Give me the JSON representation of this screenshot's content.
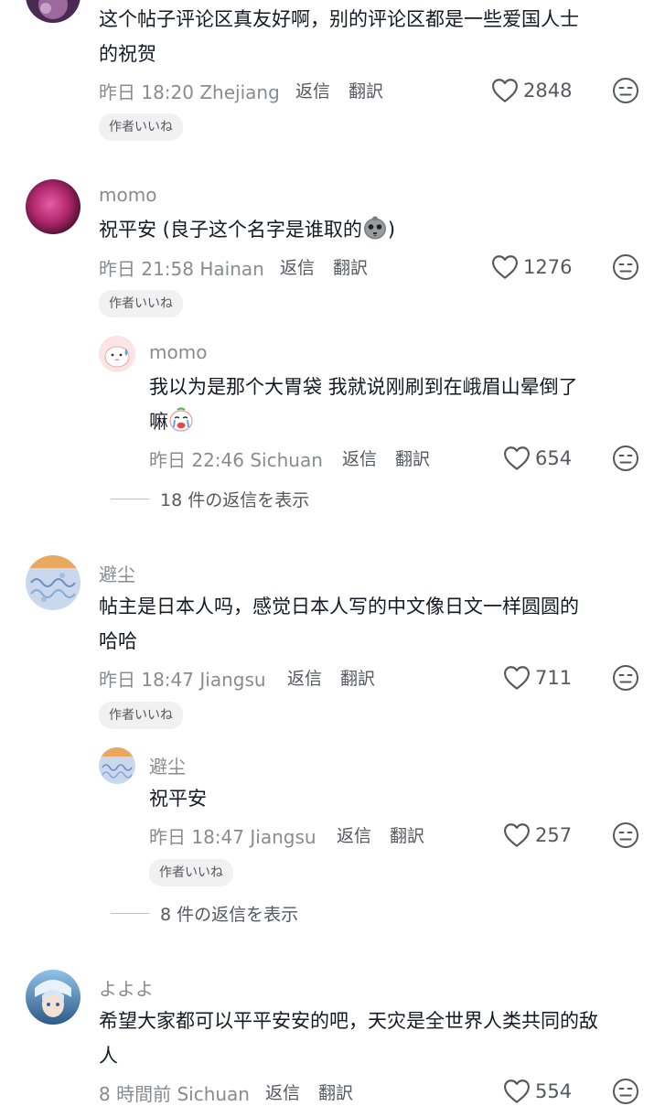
{
  "comments": [
    {
      "text_line1": "这个帖子评论区真友好啊，别的评论区都是一些爱国人士",
      "text_line2": "的祝贺",
      "time": "昨日 18:20",
      "location": "Zhejiang",
      "reply": "返信",
      "translate": "翻訳",
      "likes": "2848",
      "author_liked": "作者いいね",
      "avatar_color": "#4a2a55"
    },
    {
      "username": "momo",
      "text_line1": "祝平安 (良子这个名字是谁取的",
      "text_line1_end": ")",
      "emoji": "skull-emoji",
      "time": "昨日 21:58",
      "location": "Hainan",
      "reply": "返信",
      "translate": "翻訳",
      "likes": "1276",
      "author_liked": "作者いいね",
      "avatar_color": "#b0286e",
      "replies": [
        {
          "username": "momo",
          "text_line1": "我以为是那个大胃袋 我就说刚刷到在峨眉山晕倒了",
          "text_line2": "嘛",
          "emoji": "crying-face-emoji",
          "time": "昨日 22:46",
          "location": "Sichuan",
          "reply": "返信",
          "translate": "翻訳",
          "likes": "654"
        }
      ],
      "show_replies": "18 件の返信を表示"
    },
    {
      "username": "避尘",
      "text_line1": "帖主是日本人吗，感觉日本人写的中文像日文一样圆圆的",
      "text_line2": "哈哈",
      "time": "昨日 18:47",
      "location": "Jiangsu",
      "reply": "返信",
      "translate": "翻訳",
      "likes": "711",
      "author_liked": "作者いいね",
      "avatar_color": "#c9d8ec",
      "replies": [
        {
          "username": "避尘",
          "text_line1": "祝平安",
          "time": "昨日 18:47",
          "location": "Jiangsu",
          "reply": "返信",
          "translate": "翻訳",
          "likes": "257",
          "author_liked": "作者いいね"
        }
      ],
      "show_replies": "8 件の返信を表示"
    },
    {
      "username": "よよよ",
      "text_line1": "希望大家都可以平平安安的吧，天灾是全世界人类共同的敌",
      "text_line2": "人",
      "time": "8 時間前",
      "location": "Sichuan",
      "reply": "返信",
      "translate": "翻訳",
      "likes": "554",
      "avatar_color": "#3d6d98"
    }
  ],
  "colors": {
    "primary_text": "#161823",
    "secondary_text": "#8a8b91",
    "action_text": "#57585f",
    "badge_bg": "#f1f1f2"
  },
  "icons": {
    "like": "heart-outline-icon",
    "dislike": "neutral-face-icon"
  }
}
